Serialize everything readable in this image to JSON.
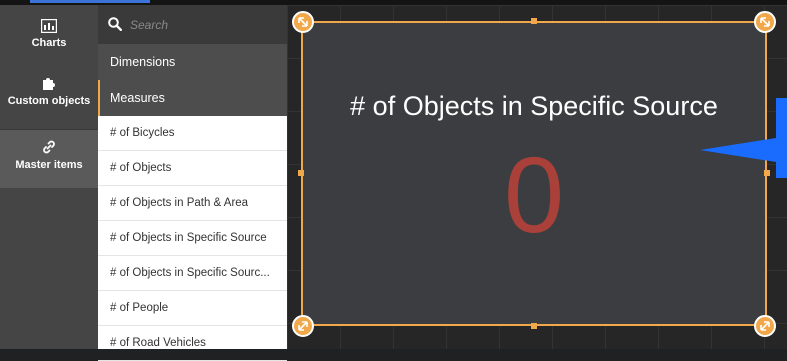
{
  "rail": {
    "items": [
      {
        "label": "Charts",
        "icon": "bar-chart-icon"
      },
      {
        "label": "Custom objects",
        "icon": "puzzle-icon"
      },
      {
        "label": "Master items",
        "icon": "link-icon"
      }
    ]
  },
  "search": {
    "placeholder": "Search",
    "value": ""
  },
  "panel": {
    "dimensions_label": "Dimensions",
    "measures_label": "Measures",
    "measures": [
      "# of Bicycles",
      "# of Objects",
      "# of Objects in Path & Area",
      "# of Objects in Specific Source",
      "# of Objects in Specific Sourc...",
      "# of People",
      "# of Road Vehicles"
    ]
  },
  "kpi": {
    "title": "# of Objects in Specific Source",
    "value": "0"
  },
  "colors": {
    "accent": "#f0a84b",
    "kpi_value": "#a9413a",
    "kpi_bg": "#3b3d40",
    "highlight_blue": "#1a6cff"
  }
}
